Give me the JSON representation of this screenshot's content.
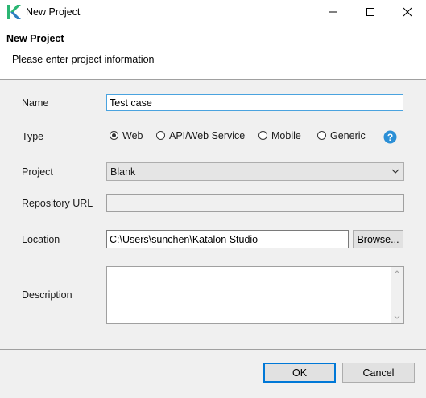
{
  "window": {
    "title": "New Project",
    "logo_icon": "katalon-logo-icon",
    "controls": [
      "minimize-icon",
      "maximize-icon",
      "close-icon"
    ]
  },
  "header": {
    "title": "New Project",
    "message": "Please enter project information"
  },
  "form": {
    "name": {
      "label": "Name",
      "value": "Test case"
    },
    "type": {
      "label": "Type",
      "options": [
        "Web",
        "API/Web Service",
        "Mobile",
        "Generic"
      ],
      "selected": "Web",
      "help_icon": "help-icon"
    },
    "project": {
      "label": "Project",
      "value": "Blank"
    },
    "repository_url": {
      "label": "Repository URL",
      "value": ""
    },
    "location": {
      "label": "Location",
      "value": "C:\\Users\\sunchen\\Katalon Studio",
      "browse_label": "Browse..."
    },
    "description": {
      "label": "Description",
      "value": ""
    }
  },
  "footer": {
    "ok_label": "OK",
    "cancel_label": "Cancel"
  },
  "colors": {
    "logo_green": "#2bb673",
    "logo_blue": "#2d7fc1",
    "help_blue": "#2b8fd6",
    "focus_border": "#4aa3df",
    "default_button_border": "#0078d7"
  }
}
